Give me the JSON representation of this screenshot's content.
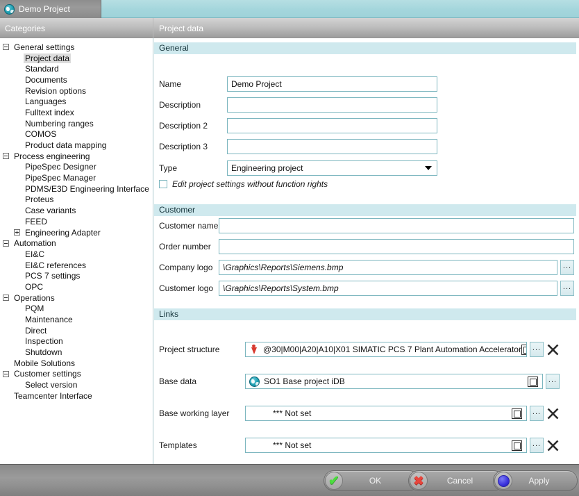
{
  "window": {
    "tab_title": "Demo Project",
    "tab_icon": "globe-icon"
  },
  "headers": {
    "categories": "Categories",
    "project_data": "Project data"
  },
  "sidebar": {
    "items": [
      {
        "label": "General settings",
        "level": 0,
        "twisty": "minus"
      },
      {
        "label": "Project data",
        "level": 1,
        "twisty": "none",
        "selected": true
      },
      {
        "label": "Standard",
        "level": 1,
        "twisty": "none"
      },
      {
        "label": "Documents",
        "level": 1,
        "twisty": "none"
      },
      {
        "label": "Revision options",
        "level": 1,
        "twisty": "none"
      },
      {
        "label": "Languages",
        "level": 1,
        "twisty": "none"
      },
      {
        "label": "Fulltext index",
        "level": 1,
        "twisty": "none"
      },
      {
        "label": "Numbering ranges",
        "level": 1,
        "twisty": "none"
      },
      {
        "label": "COMOS",
        "level": 1,
        "twisty": "none"
      },
      {
        "label": "Product data mapping",
        "level": 1,
        "twisty": "none"
      },
      {
        "label": "Process engineering",
        "level": 0,
        "twisty": "minus"
      },
      {
        "label": "PipeSpec Designer",
        "level": 1,
        "twisty": "none"
      },
      {
        "label": "PipeSpec Manager",
        "level": 1,
        "twisty": "none"
      },
      {
        "label": "PDMS/E3D Engineering Interface",
        "level": 1,
        "twisty": "none"
      },
      {
        "label": "Proteus",
        "level": 1,
        "twisty": "none"
      },
      {
        "label": "Case variants",
        "level": 1,
        "twisty": "none"
      },
      {
        "label": "FEED",
        "level": 1,
        "twisty": "none"
      },
      {
        "label": "Engineering Adapter",
        "level": 1,
        "twisty": "plus"
      },
      {
        "label": "Automation",
        "level": 0,
        "twisty": "minus"
      },
      {
        "label": "EI&C",
        "level": 1,
        "twisty": "none"
      },
      {
        "label": "EI&C references",
        "level": 1,
        "twisty": "none"
      },
      {
        "label": "PCS 7 settings",
        "level": 1,
        "twisty": "none"
      },
      {
        "label": "OPC",
        "level": 1,
        "twisty": "none"
      },
      {
        "label": "Operations",
        "level": 0,
        "twisty": "minus"
      },
      {
        "label": "PQM",
        "level": 1,
        "twisty": "none"
      },
      {
        "label": "Maintenance",
        "level": 1,
        "twisty": "none"
      },
      {
        "label": "Direct",
        "level": 1,
        "twisty": "none"
      },
      {
        "label": "Inspection",
        "level": 1,
        "twisty": "none"
      },
      {
        "label": "Shutdown",
        "level": 1,
        "twisty": "none"
      },
      {
        "label": "Mobile Solutions",
        "level": 0,
        "twisty": "none"
      },
      {
        "label": "Customer settings",
        "level": 0,
        "twisty": "minus"
      },
      {
        "label": "Select version",
        "level": 1,
        "twisty": "none"
      },
      {
        "label": "Teamcenter Interface",
        "level": 0,
        "twisty": "none"
      }
    ]
  },
  "general": {
    "section_title": "General",
    "name_label": "Name",
    "name_value": "Demo Project",
    "description_label": "Description",
    "description_value": "",
    "description2_label": "Description 2",
    "description2_value": "",
    "description3_label": "Description 3",
    "description3_value": "",
    "type_label": "Type",
    "type_value": "Engineering project",
    "edit_rights_label": "Edit project settings without function rights",
    "edit_rights_checked": false
  },
  "customer": {
    "section_title": "Customer",
    "name_label": "Customer name",
    "name_value": "",
    "order_label": "Order number",
    "order_value": "",
    "company_logo_label": "Company logo",
    "company_logo_value": "\\Graphics\\Reports\\Siemens.bmp",
    "customer_logo_label": "Customer logo",
    "customer_logo_value": "\\Graphics\\Reports\\System.bmp",
    "browse_label": "..."
  },
  "links": {
    "section_title": "Links",
    "browse_label": "...",
    "rows": [
      {
        "label": "Project structure",
        "value": "@30|M00|A20|A10|X01   SIMATIC PCS 7 Plant Automation Accelerator",
        "icon": "pin-icon",
        "has_delete": true
      },
      {
        "label": "Base data",
        "value": "SO1   Base project iDB",
        "icon": "globe-icon",
        "has_delete": false
      },
      {
        "label": "Base working layer",
        "value": "*** Not set",
        "icon": "none",
        "has_delete": true
      },
      {
        "label": "Templates",
        "value": "*** Not set",
        "icon": "none",
        "has_delete": true
      }
    ]
  },
  "buttons": {
    "ok": "OK",
    "cancel": "Cancel",
    "apply": "Apply"
  },
  "colors": {
    "accent_teal": "#9ed2d9",
    "section_band": "#cfe9ee",
    "field_border": "#7cb6bf",
    "ok_green": "#4cdd3f",
    "cancel_red": "#e8453c",
    "apply_blue": "#3a32dd"
  }
}
